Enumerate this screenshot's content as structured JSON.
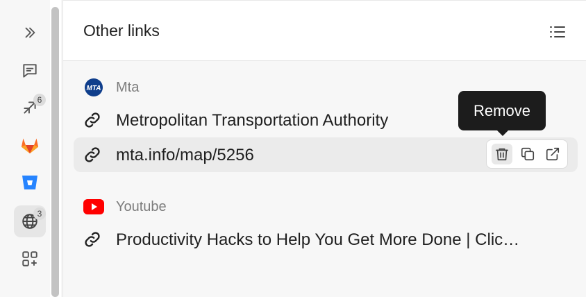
{
  "sidebar": {
    "items": [
      {
        "name": "expand",
        "icon": "double-chevron-right-icon"
      },
      {
        "name": "comments",
        "icon": "message-square-icon"
      },
      {
        "name": "pull-requests",
        "icon": "arrows-diagonal-icon",
        "badge": "6"
      },
      {
        "name": "gitlab",
        "icon": "gitlab-logo-icon"
      },
      {
        "name": "bitbucket",
        "icon": "bitbucket-logo-icon"
      },
      {
        "name": "web-links",
        "icon": "globe-icon",
        "badge": "3",
        "active": true
      },
      {
        "name": "add-integration",
        "icon": "grid-plus-icon"
      }
    ]
  },
  "panel": {
    "title": "Other links"
  },
  "groups": [
    {
      "label": "Mta",
      "logo_text": "MTA",
      "links": [
        {
          "text": "Metropolitan Transportation Authority"
        },
        {
          "text": "mta.info/map/5256"
        }
      ]
    },
    {
      "label": "Youtube",
      "links": [
        {
          "text": "Productivity Hacks to Help You Get More Done | Clic…"
        }
      ]
    }
  ],
  "row_actions": {
    "tooltip": "Remove"
  },
  "colors": {
    "accent_mta": "#0f3e8c",
    "youtube_red": "#ff0000",
    "gitlab_orange": "#e24329",
    "bitbucket_blue": "#2684ff"
  }
}
